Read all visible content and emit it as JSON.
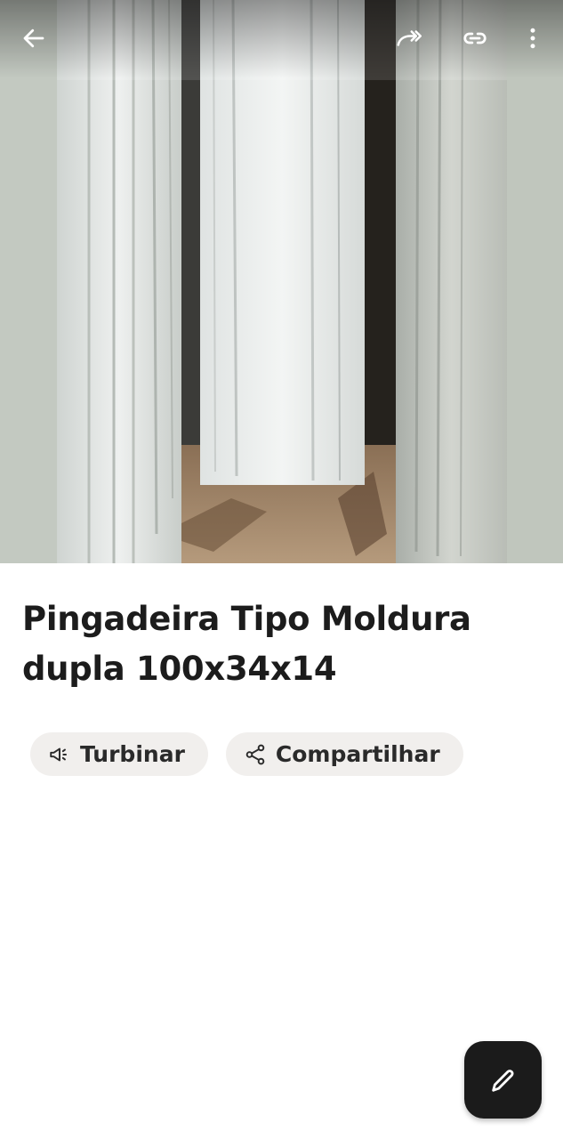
{
  "app_bar": {
    "back_icon": "arrow-left-icon",
    "share_icon": "forward-arrow-icon",
    "link_icon": "link-icon",
    "more_icon": "more-vertical-icon"
  },
  "listing": {
    "title": "Pingadeira Tipo Moldura dupla 100x34x14"
  },
  "actions": {
    "boost": {
      "label": "Turbinar",
      "icon": "megaphone-icon"
    },
    "share": {
      "label": "Compartilhar",
      "icon": "share-nodes-icon"
    }
  },
  "fab": {
    "icon": "pencil-icon"
  },
  "colors": {
    "text": "#1c1c1c",
    "chip_bg": "#f1efed",
    "fab_bg": "#1b1b1b",
    "image_bg": "#c3c9c1"
  }
}
